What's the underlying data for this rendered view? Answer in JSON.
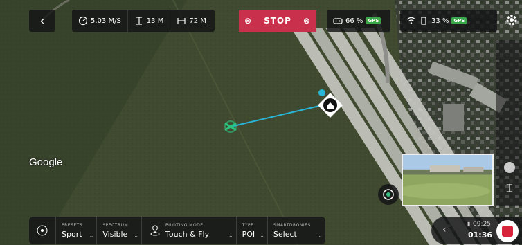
{
  "top_bar": {
    "speed": "5.03 M/S",
    "altitude": "13 M",
    "distance": "72 M",
    "stop_label": "STOP",
    "controller_battery": "66 %",
    "controller_gps": "GPS",
    "drone_battery": "33 %",
    "drone_gps": "GPS"
  },
  "map": {
    "attribution": "Google"
  },
  "bottom_bar": {
    "presets_caption": "PRESETS",
    "presets_value": "Sport",
    "spectrum_caption": "SPECTRUM",
    "spectrum_value": "Visible",
    "piloting_caption": "PILOTING MODE",
    "piloting_value": "Touch & Fly",
    "type_caption": "TYPE",
    "type_value": "POI",
    "smartdronies_caption": "SMARTDRONIES",
    "smartdronies_value": "Select"
  },
  "recording": {
    "clock": "09:25",
    "duration": "01:36"
  },
  "colors": {
    "stop_red": "#c9304b",
    "gps_green": "#3aa84a",
    "path_cyan": "#28b6d8",
    "drone_green": "#2ec27e"
  }
}
